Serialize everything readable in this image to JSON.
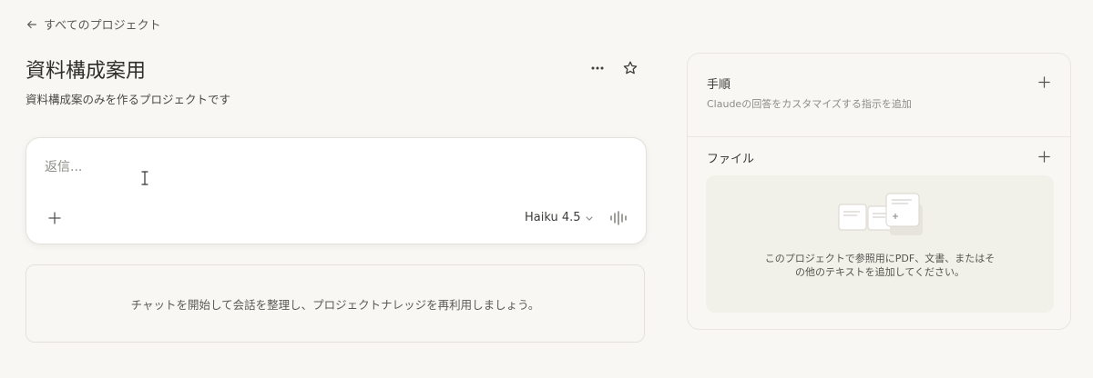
{
  "nav": {
    "back_label": "すべてのプロジェクト"
  },
  "project": {
    "title": "資料構成案用",
    "description": "資料構成案のみを作るプロジェクトです"
  },
  "composer": {
    "placeholder": "返信...",
    "model": "Haiku 4.5"
  },
  "chats": {
    "empty_message": "チャットを開始して会話を整理し、プロジェクトナレッジを再利用しましょう。"
  },
  "side_panel": {
    "instructions_title": "手順",
    "instructions_desc": "Claudeの回答をカスタマイズする指示を追加",
    "files_title": "ファイル",
    "files_empty": "このプロジェクトで参照用にPDF、文書、またはその他のテキストを追加してください。"
  },
  "icons": {
    "back": "arrow-left-icon",
    "more": "more-horizontal-icon",
    "star": "star-icon",
    "add": "plus-icon",
    "model_dropdown": "chevron-down-icon",
    "voice": "voice-waveform-icon"
  }
}
